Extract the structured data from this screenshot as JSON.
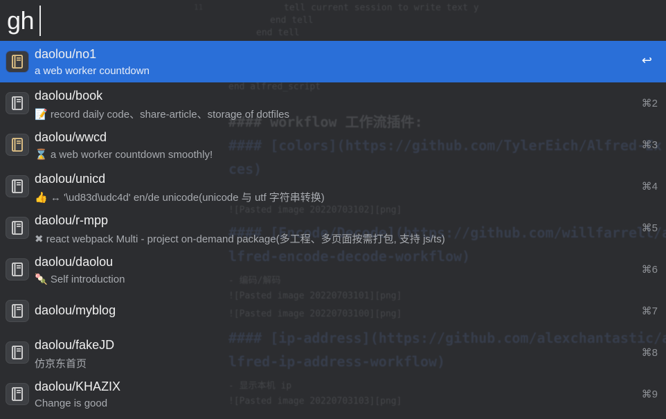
{
  "search": {
    "query": "gh"
  },
  "results": [
    {
      "title": "daolou/no1",
      "subtitle": "a web worker countdown",
      "shortcut": "↩",
      "selected": true,
      "icon": "book-icon",
      "icon_color": "#e9c98a"
    },
    {
      "title": "daolou/book",
      "subtitle": "📝  record daily code、share-article、storage of dotfiles",
      "shortcut": "⌘2",
      "icon": "book-icon",
      "icon_color": "#dcdcdc"
    },
    {
      "title": "daolou/wwcd",
      "subtitle": "⌛ a web worker countdown smoothly!",
      "shortcut": "⌘3",
      "icon": "book-icon",
      "icon_color": "#e9c98a"
    },
    {
      "title": "daolou/unicd",
      "subtitle": "👍    ↔    '\\ud83d\\udc4d' en/de unicode(unicode 与 utf 字符串转换)",
      "shortcut": "⌘4",
      "icon": "book-icon",
      "icon_color": "#dcdcdc"
    },
    {
      "title": "daolou/r-mpp",
      "subtitle": "✖   react webpack Multi - project on-demand package(多工程、多页面按需打包, 支持 js/ts)",
      "shortcut": "⌘5",
      "icon": "book-icon",
      "icon_color": "#dcdcdc"
    },
    {
      "title": "daolou/daolou",
      "subtitle": "🍡  Self introduction",
      "shortcut": "⌘6",
      "icon": "book-icon",
      "icon_color": "#dcdcdc"
    },
    {
      "title": "daolou/myblog",
      "subtitle": "",
      "shortcut": "⌘7",
      "icon": "book-icon",
      "icon_color": "#dcdcdc"
    },
    {
      "title": "daolou/fakeJD",
      "subtitle": "仿京东首页",
      "shortcut": "⌘8",
      "icon": "book-icon",
      "icon_color": "#dcdcdc"
    },
    {
      "title": "daolou/KHAZIX",
      "subtitle": "Change is good",
      "shortcut": "⌘9",
      "icon": "book-icon",
      "icon_color": "#dcdcdc"
    }
  ],
  "colors": {
    "selected_bg": "#2a6fd8",
    "window_bg": "#2c2d30"
  }
}
